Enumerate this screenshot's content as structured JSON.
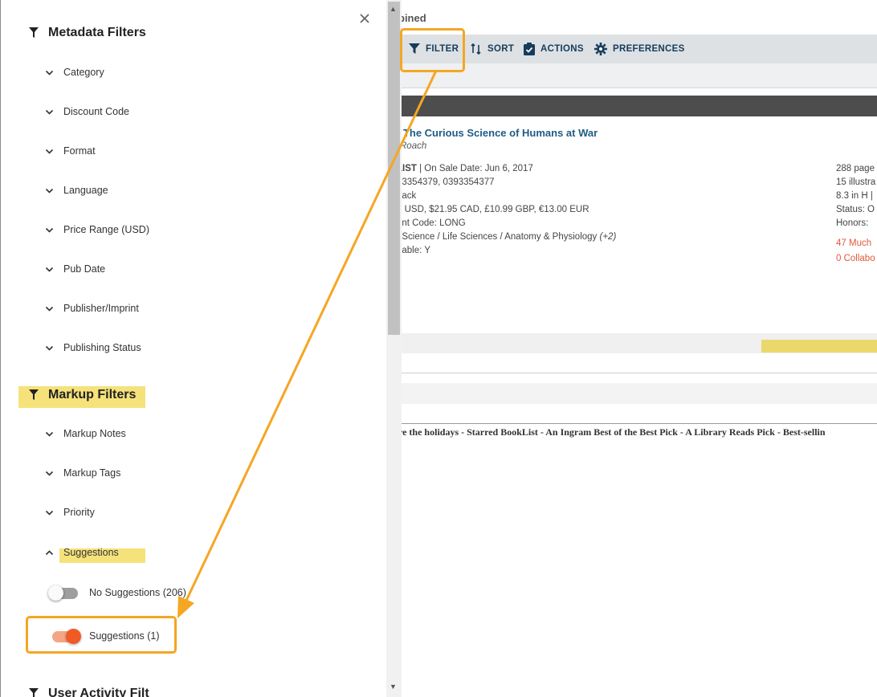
{
  "panel": {
    "metadata_title": "Metadata Filters",
    "metadata_items": [
      "Category",
      "Discount Code",
      "Format",
      "Language",
      "Price Range (USD)",
      "Pub Date",
      "Publisher/Imprint",
      "Publishing Status"
    ],
    "markup_title": "Markup Filters",
    "markup_items": [
      "Markup Notes",
      "Markup Tags",
      "Priority"
    ],
    "suggestions_label": "Suggestions",
    "toggle_no_suggestions": "No Suggestions (206)",
    "toggle_no_suggestions_on": false,
    "toggle_suggestions": "Suggestions (1)",
    "toggle_suggestions_on": true,
    "cut_section": "User Activity Filt"
  },
  "main": {
    "crumb": "bined",
    "toolbar": {
      "filter": "FILTER",
      "sort": "SORT",
      "actions": "ACTIONS",
      "preferences": "PREFERENCES"
    },
    "book": {
      "title": ": The Curious Science of Humans at War",
      "author": "Roach",
      "line1_a": "LIST",
      "line1_b": " | On Sale Date: Jun 6, 2017",
      "isbn": "93354379, 0393354377",
      "format": "back",
      "price": "5 USD, $21.95 CAD, £10.99 GBP, €13.00 EUR",
      "discount": "unt Code: LONG",
      "subject": ": Science / Life Sciences / Anatomy & Physiology",
      "subject_more": "(+2)",
      "returnable": "nable: Y",
      "pages": "288 page",
      "illus": "15 illustra",
      "size": "8.3 in H |",
      "status": "Status: O",
      "honors": "Honors:",
      "much": "47 Much",
      "collab": "0 Collabo"
    },
    "accolades": "re the holidays - Starred BookList - An Ingram Best of the Best Pick - A Library Reads Pick - Best-sellin"
  },
  "colors": {
    "accent_orange": "#f5a623",
    "highlight_yellow": "#f5e27a",
    "toggle_on": "#f15a24",
    "link_blue": "#1f5b84"
  }
}
